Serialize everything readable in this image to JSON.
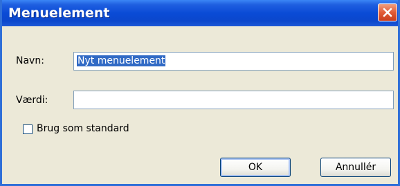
{
  "dialog": {
    "title": "Menuelement",
    "close_icon": "close-icon",
    "accent_color": "#0b4bd6"
  },
  "form": {
    "name_label": "Navn:",
    "name_value": "Nyt menuelement",
    "value_label": "Værdi:",
    "value_value": "",
    "checkbox_label": "Brug som standard",
    "checkbox_checked": false
  },
  "buttons": {
    "ok_label": "OK",
    "cancel_label": "Annullér"
  }
}
